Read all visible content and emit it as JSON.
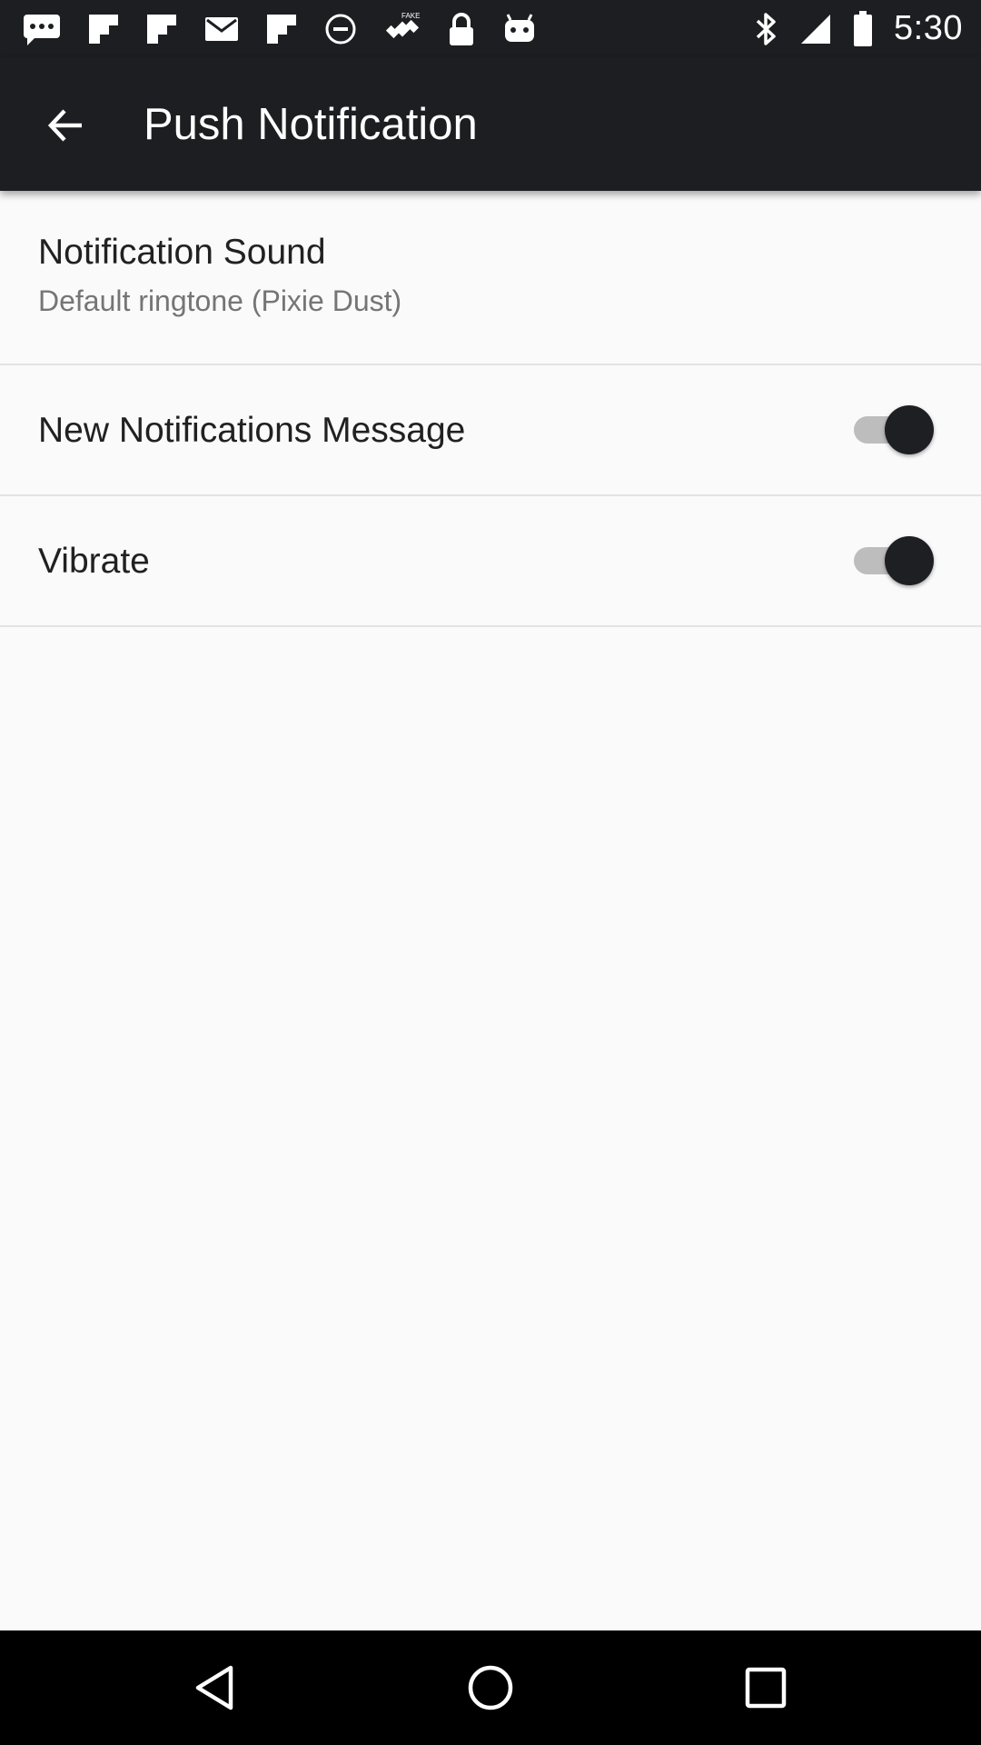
{
  "status_bar": {
    "time": "5:30",
    "left_icons": [
      "message-icon",
      "flipboard-icon",
      "flipboard-icon",
      "email-icon",
      "flipboard-icon",
      "circle-icon",
      "satellite-fake-gps-icon",
      "lock-icon",
      "android-icon"
    ],
    "right_icons": [
      "bluetooth-icon",
      "signal-icon",
      "battery-icon"
    ]
  },
  "app_bar": {
    "title": "Push Notification",
    "back_icon": "arrow-back-icon",
    "background": "#1d1e21"
  },
  "preferences": {
    "notification_sound": {
      "title": "Notification Sound",
      "summary": "Default ringtone (Pixie Dust)"
    },
    "new_notifications_message": {
      "title": "New Notifications Message",
      "enabled": true
    },
    "vibrate": {
      "title": "Vibrate",
      "enabled": true
    }
  },
  "nav_bar": {
    "buttons": [
      "back-triangle-icon",
      "home-circle-icon",
      "recents-square-icon"
    ]
  },
  "colors": {
    "background": "#fafafa",
    "primary_text": "#212121",
    "secondary_text": "#757575",
    "switch_thumb": "#1e1f22",
    "switch_track": "#bdbdbd"
  }
}
